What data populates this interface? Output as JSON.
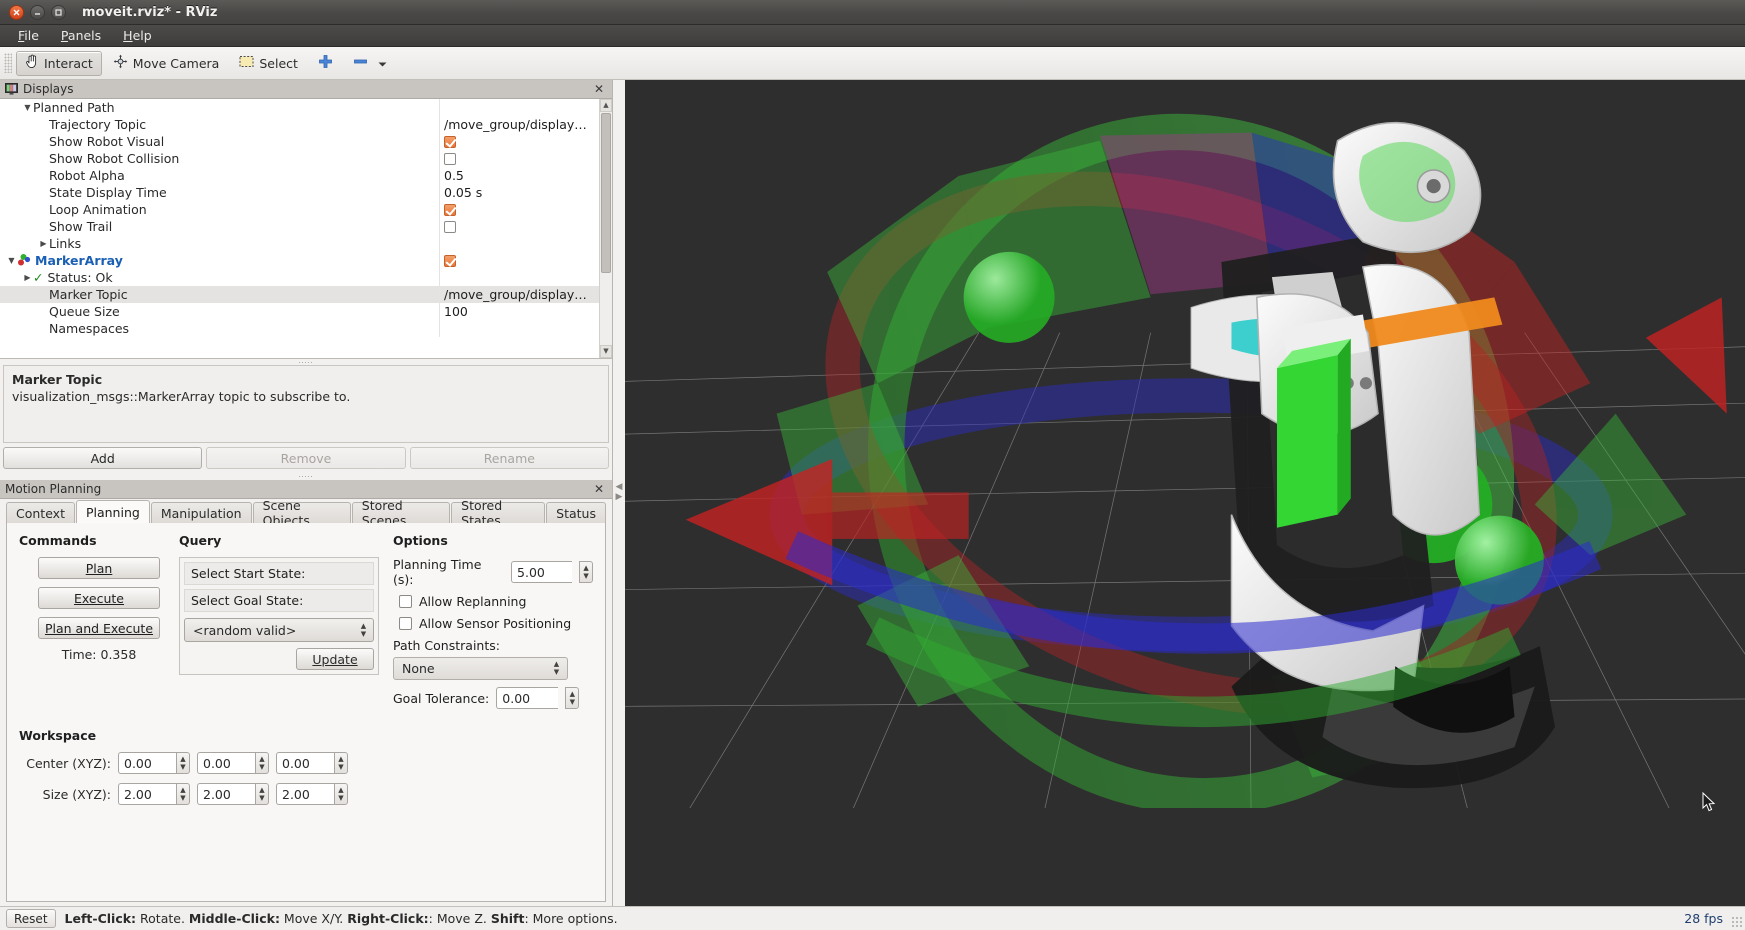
{
  "window": {
    "title": "moveit.rviz* - RViz",
    "buttons": {
      "close": "close-icon",
      "minimize": "minimize-icon",
      "maximize": "maximize-icon"
    }
  },
  "menubar": {
    "items": [
      {
        "label": "File",
        "accel": "F"
      },
      {
        "label": "Panels",
        "accel": "P"
      },
      {
        "label": "Help",
        "accel": "H"
      }
    ]
  },
  "toolbar": {
    "items": [
      {
        "label": "Interact",
        "icon": "hand-cursor-icon",
        "active": true
      },
      {
        "label": "Move Camera",
        "icon": "move-camera-icon",
        "active": false
      },
      {
        "label": "Select",
        "icon": "select-rect-icon",
        "active": false
      },
      {
        "label": "",
        "icon": "plus-icon",
        "active": false
      },
      {
        "label": "",
        "icon": "minus-icon",
        "active": false
      },
      {
        "label": "",
        "icon": "chevron-down-icon",
        "active": false
      }
    ]
  },
  "displays_panel": {
    "title": "Displays",
    "icon": "displays-icon",
    "close": "✕",
    "rows": [
      {
        "indent": 1,
        "twisty": "▼",
        "label": "Planned Path",
        "value": "",
        "kind": "text",
        "selected": false,
        "bold": false
      },
      {
        "indent": 2,
        "twisty": "",
        "label": "Trajectory Topic",
        "value": "/move_group/display…",
        "kind": "text",
        "selected": false,
        "bold": false
      },
      {
        "indent": 2,
        "twisty": "",
        "label": "Show Robot Visual",
        "value": "",
        "kind": "check-on",
        "selected": false,
        "bold": false
      },
      {
        "indent": 2,
        "twisty": "",
        "label": "Show Robot Collision",
        "value": "",
        "kind": "check-off",
        "selected": false,
        "bold": false
      },
      {
        "indent": 2,
        "twisty": "",
        "label": "Robot Alpha",
        "value": "0.5",
        "kind": "text",
        "selected": false,
        "bold": false
      },
      {
        "indent": 2,
        "twisty": "",
        "label": "State Display Time",
        "value": "0.05 s",
        "kind": "text",
        "selected": false,
        "bold": false
      },
      {
        "indent": 2,
        "twisty": "",
        "label": "Loop Animation",
        "value": "",
        "kind": "check-on",
        "selected": false,
        "bold": false
      },
      {
        "indent": 2,
        "twisty": "",
        "label": "Show Trail",
        "value": "",
        "kind": "check-off",
        "selected": false,
        "bold": false
      },
      {
        "indent": 2,
        "twisty": "▶",
        "label": "Links",
        "value": "",
        "kind": "text",
        "selected": false,
        "bold": false
      },
      {
        "indent": 0,
        "twisty": "▼",
        "label": "MarkerArray",
        "value": "",
        "kind": "check-on",
        "selected": false,
        "bold": true,
        "icon": "markerarray-icon"
      },
      {
        "indent": 1,
        "twisty": "▶",
        "label": "Status: Ok",
        "value": "",
        "kind": "status-ok",
        "selected": false,
        "bold": false
      },
      {
        "indent": 2,
        "twisty": "",
        "label": "Marker Topic",
        "value": "/move_group/display…",
        "kind": "text",
        "selected": true,
        "bold": false
      },
      {
        "indent": 2,
        "twisty": "",
        "label": "Queue Size",
        "value": "100",
        "kind": "text",
        "selected": false,
        "bold": false
      },
      {
        "indent": 2,
        "twisty": "",
        "label": "Namespaces",
        "value": "",
        "kind": "text",
        "selected": false,
        "bold": false
      }
    ]
  },
  "description": {
    "title": "Marker Topic",
    "text": "visualization_msgs::MarkerArray topic to subscribe to."
  },
  "display_buttons": [
    {
      "label": "Add",
      "disabled": false
    },
    {
      "label": "Remove",
      "disabled": true
    },
    {
      "label": "Rename",
      "disabled": true
    }
  ],
  "motion_planning": {
    "title": "Motion Planning",
    "close": "✕",
    "tabs": [
      {
        "label": "Context",
        "active": false
      },
      {
        "label": "Planning",
        "active": true
      },
      {
        "label": "Manipulation",
        "active": false
      },
      {
        "label": "Scene Objects",
        "active": false
      },
      {
        "label": "Stored Scenes",
        "active": false
      },
      {
        "label": "Stored States",
        "active": false
      },
      {
        "label": "Status",
        "active": false
      }
    ],
    "commands": {
      "title": "Commands",
      "buttons": [
        {
          "label": "Plan",
          "accel": "P"
        },
        {
          "label": "Execute",
          "accel": "E"
        },
        {
          "label": "Plan and Execute",
          "accel": "x"
        }
      ],
      "time_label": "Time: 0.358"
    },
    "query": {
      "title": "Query",
      "start_state_label": "Select Start State:",
      "goal_state_label": "Select Goal State:",
      "goal_state_value": "<random valid>",
      "update_label": "Update"
    },
    "options": {
      "title": "Options",
      "planning_time_label": "Planning Time (s):",
      "planning_time_value": "5.00",
      "allow_replanning_label": "Allow Replanning",
      "allow_replanning_checked": false,
      "allow_sensor_label": "Allow Sensor Positioning",
      "allow_sensor_checked": false,
      "path_constraints_label": "Path Constraints:",
      "path_constraints_value": "None",
      "goal_tolerance_label": "Goal Tolerance:",
      "goal_tolerance_value": "0.00"
    },
    "workspace": {
      "title": "Workspace",
      "center_label": "Center (XYZ):",
      "center_values": [
        "0.00",
        "0.00",
        "0.00"
      ],
      "size_label": "Size (XYZ):",
      "size_values": [
        "2.00",
        "2.00",
        "2.00"
      ]
    }
  },
  "statusbar": {
    "reset_label": "Reset",
    "hint_parts": [
      {
        "text": "Left-Click:",
        "bold": true
      },
      {
        "text": " Rotate. ",
        "bold": false
      },
      {
        "text": "Middle-Click:",
        "bold": true
      },
      {
        "text": " Move X/Y. ",
        "bold": false
      },
      {
        "text": "Right-Click:",
        "bold": true
      },
      {
        "text": ": Move Z. ",
        "bold": false
      },
      {
        "text": "Shift",
        "bold": true
      },
      {
        "text": ": More options.",
        "bold": false
      }
    ],
    "fps": "28 fps"
  },
  "viewport": {
    "background_color": "#2e2e2e",
    "grid_color": "#9a9a9a",
    "cursor": "arrow-cursor",
    "markers": {
      "x_axis_color": "#cc2222",
      "y_axis_color": "#22aa22",
      "z_axis_color": "#2222cc",
      "object_color": "#3ddb3d"
    }
  }
}
